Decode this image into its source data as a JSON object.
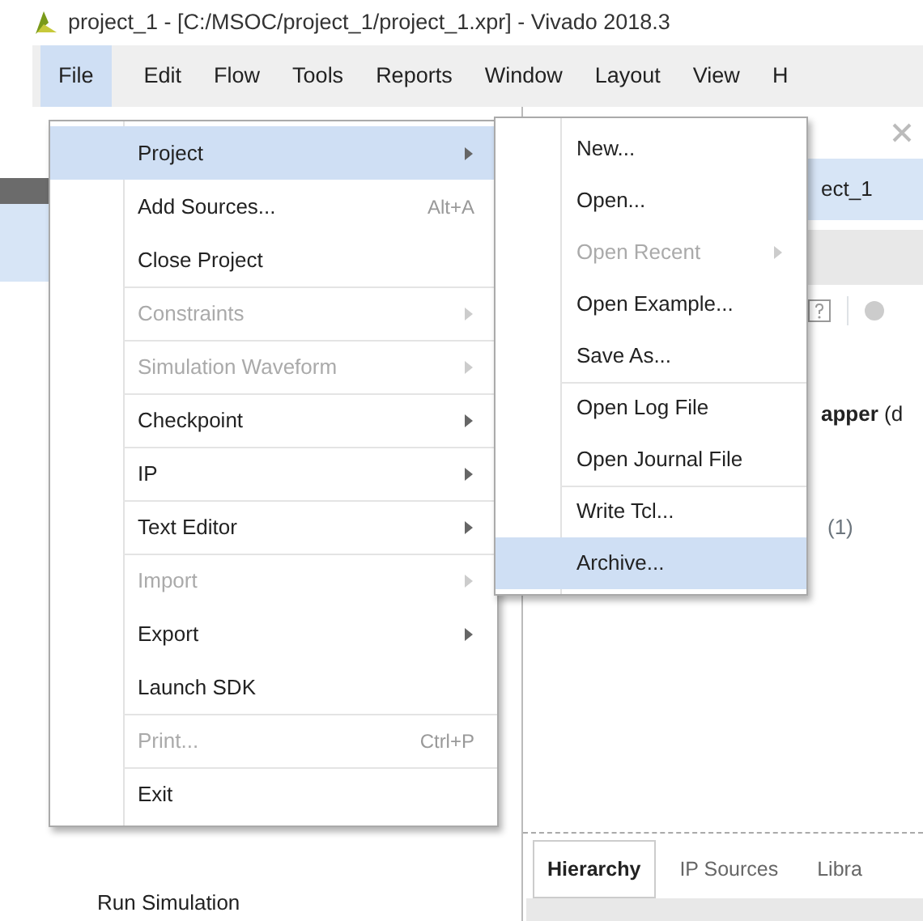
{
  "window": {
    "title": "project_1 - [C:/MSOC/project_1/project_1.xpr] - Vivado 2018.3"
  },
  "menubar": [
    {
      "label": "File",
      "selected": true
    },
    {
      "label": "Edit",
      "selected": false
    },
    {
      "label": "Flow",
      "selected": false
    },
    {
      "label": "Tools",
      "selected": false
    },
    {
      "label": "Reports",
      "selected": false
    },
    {
      "label": "Window",
      "selected": false
    },
    {
      "label": "Layout",
      "selected": false
    },
    {
      "label": "View",
      "selected": false
    },
    {
      "label": "H",
      "selected": false
    }
  ],
  "file_menu": [
    {
      "label": "Project",
      "submenu": true,
      "disabled": false,
      "selected": true,
      "separator_before": false
    },
    {
      "label": "Add Sources...",
      "shortcut": "Alt+A",
      "submenu": false,
      "disabled": false,
      "selected": false,
      "separator_before": false
    },
    {
      "label": "Close Project",
      "submenu": false,
      "disabled": false,
      "selected": false,
      "separator_before": false
    },
    {
      "label": "Constraints",
      "submenu": true,
      "disabled": true,
      "selected": false,
      "separator_before": true
    },
    {
      "label": "Simulation Waveform",
      "submenu": true,
      "disabled": true,
      "selected": false,
      "separator_before": true
    },
    {
      "label": "Checkpoint",
      "submenu": true,
      "disabled": false,
      "selected": false,
      "separator_before": true
    },
    {
      "label": "IP",
      "submenu": true,
      "disabled": false,
      "selected": false,
      "separator_before": true
    },
    {
      "label": "Text Editor",
      "submenu": true,
      "disabled": false,
      "selected": false,
      "separator_before": true
    },
    {
      "label": "Import",
      "submenu": true,
      "disabled": true,
      "selected": false,
      "separator_before": true
    },
    {
      "label": "Export",
      "submenu": true,
      "disabled": false,
      "selected": false,
      "separator_before": false
    },
    {
      "label": "Launch SDK",
      "submenu": false,
      "disabled": false,
      "selected": false,
      "separator_before": false
    },
    {
      "label": "Print...",
      "shortcut": "Ctrl+P",
      "submenu": false,
      "disabled": true,
      "selected": false,
      "separator_before": true
    },
    {
      "label": "Exit",
      "submenu": false,
      "disabled": false,
      "selected": false,
      "separator_before": true
    }
  ],
  "project_submenu": [
    {
      "label": "New...",
      "submenu": false,
      "disabled": false,
      "selected": false,
      "separator_before": false
    },
    {
      "label": "Open...",
      "submenu": false,
      "disabled": false,
      "selected": false,
      "separator_before": false
    },
    {
      "label": "Open Recent",
      "submenu": true,
      "disabled": true,
      "selected": false,
      "separator_before": false
    },
    {
      "label": "Open Example...",
      "submenu": false,
      "disabled": false,
      "selected": false,
      "separator_before": false
    },
    {
      "label": "Save As...",
      "submenu": false,
      "disabled": false,
      "selected": false,
      "separator_before": false
    },
    {
      "label": "Open Log File",
      "submenu": false,
      "disabled": false,
      "selected": false,
      "separator_before": true
    },
    {
      "label": "Open Journal File",
      "submenu": false,
      "disabled": false,
      "selected": false,
      "separator_before": false
    },
    {
      "label": "Write Tcl...",
      "submenu": false,
      "disabled": false,
      "selected": false,
      "separator_before": true
    },
    {
      "label": "Archive...",
      "submenu": false,
      "disabled": false,
      "selected": true,
      "separator_before": false
    }
  ],
  "project_header": {
    "title": "ect_1"
  },
  "sources": {
    "top_line": "**apper** (d",
    "count_line": "(1)",
    "tabs": [
      {
        "label": "Hierarchy",
        "selected": true
      },
      {
        "label": "IP Sources",
        "selected": false
      },
      {
        "label": "Libra",
        "selected": false
      }
    ]
  },
  "flow_navigator": {
    "item": "Run Simulation"
  }
}
